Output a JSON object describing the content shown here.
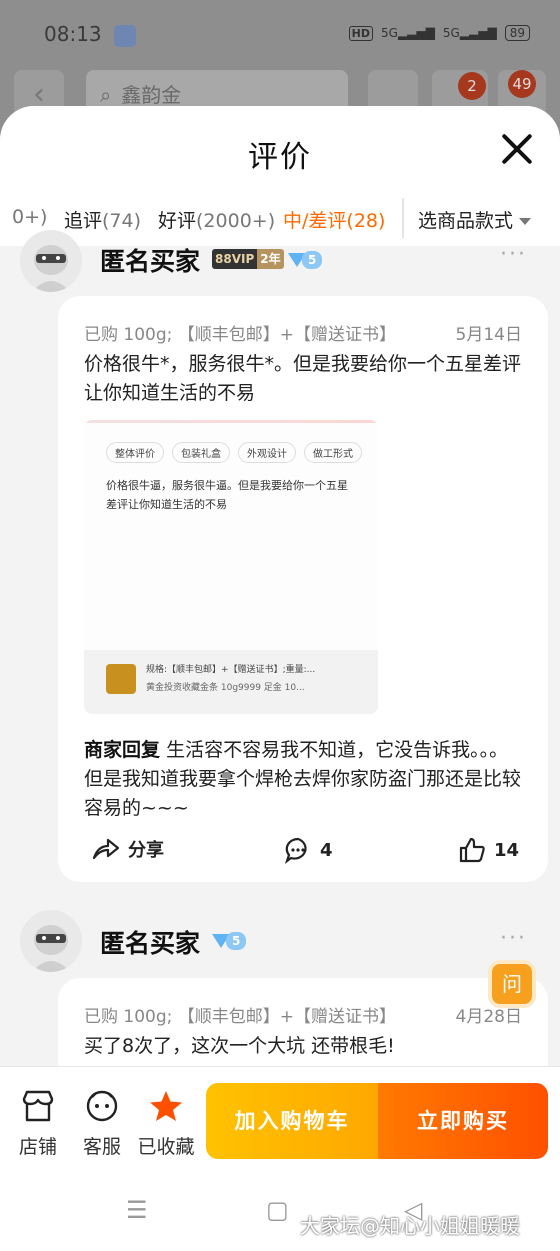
{
  "status_bar": {
    "time": "08:13",
    "hd": "HD",
    "sig1": "5G",
    "sig2": "5G",
    "battery": "89"
  },
  "bg_nav": {
    "search_text": "鑫韵金",
    "cart_badge": "2",
    "more_badge": "49"
  },
  "sheet": {
    "title": "评价"
  },
  "filters": {
    "partial": "0+)",
    "chips": [
      {
        "label": "追评",
        "count": "(74)"
      },
      {
        "label": "好评",
        "count": "(2000+)"
      },
      {
        "label": "中/差评",
        "count": "(28)"
      }
    ],
    "style_select": "选商品款式"
  },
  "reviews": [
    {
      "name": "匿名买家",
      "vip_a": "88VIP",
      "vip_b": "2年",
      "level": "5",
      "sku": "已购 100g; 【顺丰包邮】+【赠送证书】",
      "date": "5月14日",
      "text": "价格很牛*，服务很牛*。但是我要给你一个五星差评让你知道生活的不易",
      "photo": {
        "tags": [
          "整体评价",
          "包装礼盒",
          "外观设计",
          "做工形式"
        ],
        "text": "价格很牛逼，服务很牛逼。但是我要给你一个五星差评让你知道生活的不易",
        "line1": "规格:【顺丰包邮】+【赠送证书】;重量:...",
        "line2": "黄金投资收藏金条 10g9999 足金 10..."
      },
      "reply_label": "商家回复",
      "reply": "生活容不容易我不知道，它没告诉我。。。但是我知道我要拿个焊枪去焊你家防盗门那还是比较容易的~~~",
      "share": "分享",
      "comments": "4",
      "likes": "14"
    },
    {
      "name": "匿名买家",
      "level": "5",
      "sku": "已购 100g; 【顺丰包邮】+【赠送证书】",
      "date": "4月28日",
      "text": "买了8次了，这次一个大坑 还带根毛!"
    }
  ],
  "ask_button": "问",
  "bottom_bar": {
    "store": "店铺",
    "service": "客服",
    "favorited": "已收藏",
    "add_to_cart": "加入购物车",
    "buy_now": "立即购买"
  },
  "watermark": "大家坛@知心小姐姐暖暖",
  "colors": {
    "accent": "#ff6a00",
    "cart_button": "#ffb400",
    "buy_button": "#ff6000"
  }
}
